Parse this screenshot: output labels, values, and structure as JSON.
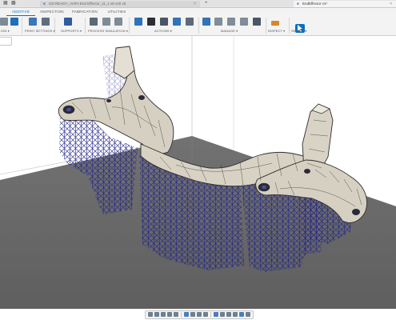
{
  "document_tabs": {
    "inactive": {
      "label": "GD READY_AVRA End Effector_11_1 v8 v15 v5"
    },
    "active": {
      "label": "EndEffector v1*"
    }
  },
  "workspace_tabs": [
    "ADDITIVE",
    "INSPECTION",
    "FABRICATION",
    "UTILITIES"
  ],
  "active_workspace": "ADDITIVE",
  "ribbon_groups": [
    {
      "label": "ION ▾"
    },
    {
      "label": "PRINT SETTINGS ▾"
    },
    {
      "label": "SUPPORTS ▾"
    },
    {
      "label": "PROCESS SIMULATION ▾"
    },
    {
      "label": "ACTIONS ▾"
    },
    {
      "label": "MANAGE ▾"
    },
    {
      "label": "INSPECT ▾"
    },
    {
      "label": "SELECT ▾"
    }
  ],
  "colors": {
    "accent": "#0a6fc2",
    "part": "#d6d0c2",
    "supports": "#23248a",
    "build_plate": "#6b6b6b"
  },
  "icons": [
    "close-icon",
    "add-tab-icon",
    "arrange-icon",
    "print-settings-icon",
    "supports-icon",
    "simulation-icon",
    "actions-icon",
    "manage-icon",
    "inspect-icon",
    "select-cursor-icon",
    "orbit-icon",
    "pan-icon",
    "zoom-icon",
    "fit-icon",
    "display-settings-icon",
    "grid-icon"
  ]
}
